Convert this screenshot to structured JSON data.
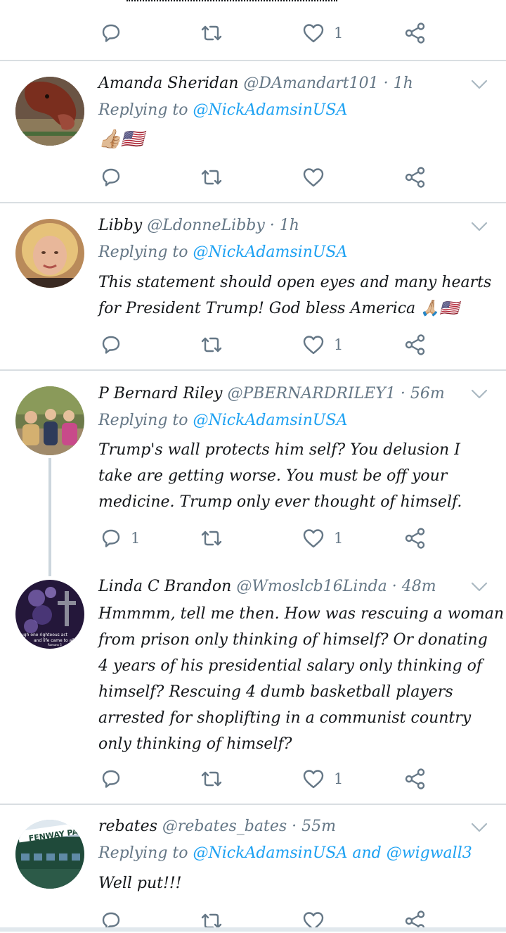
{
  "tweets": [
    {
      "counts": {
        "reply": "",
        "like": "1"
      }
    },
    {
      "name": "Amanda Sheridan",
      "handle": "@DAmandart101",
      "dot": "·",
      "time": "1h",
      "reply_prefix": "Replying to",
      "mentions": [
        "@NickAdamsinUSA"
      ],
      "body": [
        "👍🏼🇺🇸"
      ],
      "counts": {
        "reply": "",
        "like": ""
      }
    },
    {
      "name": "Libby",
      "handle": "@LdonneLibby",
      "dot": "·",
      "time": "1h",
      "reply_prefix": "Replying to",
      "mentions": [
        "@NickAdamsinUSA"
      ],
      "body": [
        "This statement should open eyes and many hearts",
        "for President Trump! God bless America 🙏🏼🇺🇸"
      ],
      "counts": {
        "reply": "",
        "like": "1"
      }
    },
    {
      "name": "P Bernard Riley",
      "handle": "@PBERNARDRILEY1",
      "dot": "·",
      "time": "56m",
      "reply_prefix": "Replying to",
      "mentions": [
        "@NickAdamsinUSA"
      ],
      "body": [
        "Trump's wall protects him self? You delusion I",
        "take are getting worse. You must be off your",
        "medicine. Trump only ever thought of himself."
      ],
      "counts": {
        "reply": "1",
        "like": "1"
      }
    },
    {
      "name": "Linda C Brandon",
      "handle": "@Wmoslcb16Linda",
      "dot": "·",
      "time": "48m",
      "body": [
        "Hmmmm, tell me then.  How was rescuing a woman",
        "from prison only thinking of himself?  Or donating",
        "4 years of his presidential salary only thinking of",
        "himself?  Rescuing 4 dumb basketball players",
        "arrested for shoplifting in a communist country",
        "only thinking of himself?"
      ],
      "counts": {
        "reply": "",
        "like": "1"
      }
    },
    {
      "name": "rebates",
      "handle": "@rebates_bates",
      "dot": "·",
      "time": "55m",
      "reply_prefix": "Replying to",
      "mentions": [
        "@NickAdamsinUSA",
        "@wigwall3"
      ],
      "mention_joiner": "and",
      "body": [
        "Well put!!!"
      ],
      "counts": {
        "reply": "",
        "like": ""
      }
    }
  ],
  "avatar_texts": {
    "linda": [
      "rough one righteous act",
      "and life came to all",
      "Romans 5"
    ],
    "rebates": "FENWAY PA"
  },
  "colors": {
    "link": "#1da1f2",
    "muted": "#657786",
    "text": "#14171a",
    "divider": "#d9dee2"
  },
  "icons": [
    "reply-icon",
    "retweet-icon",
    "like-icon",
    "share-icon",
    "chevron-down-icon"
  ]
}
